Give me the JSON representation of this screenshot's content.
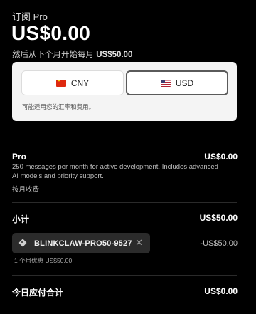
{
  "header": {
    "subscribe_label": "订阅 Pro",
    "price": "US$0.00",
    "then_prefix": "然后从下个月开始每月",
    "then_amount": "US$50.00"
  },
  "currency": {
    "options": [
      {
        "code": "CNY",
        "flag": "cn-flag-icon"
      },
      {
        "code": "USD",
        "flag": "us-flag-icon",
        "selected": true
      }
    ],
    "note": "可能适用您的汇率和费用。"
  },
  "plan": {
    "name": "Pro",
    "price": "US$0.00",
    "description": "250 messages per month for active development. Includes advanced AI models and priority support.",
    "billing": "按月收费"
  },
  "subtotal": {
    "label": "小计",
    "value": "US$50.00"
  },
  "promo": {
    "code": "BLINKCLAW-PRO50-9527",
    "discount": "-US$50.00",
    "note": "1 个月优惠 US$50.00"
  },
  "total": {
    "label": "今日应付合计",
    "value": "US$0.00"
  },
  "colors": {
    "background": "#000000",
    "card": "#f4f4f4",
    "chip": "#2b2b2b",
    "selected_border": "#5a5a5a"
  }
}
